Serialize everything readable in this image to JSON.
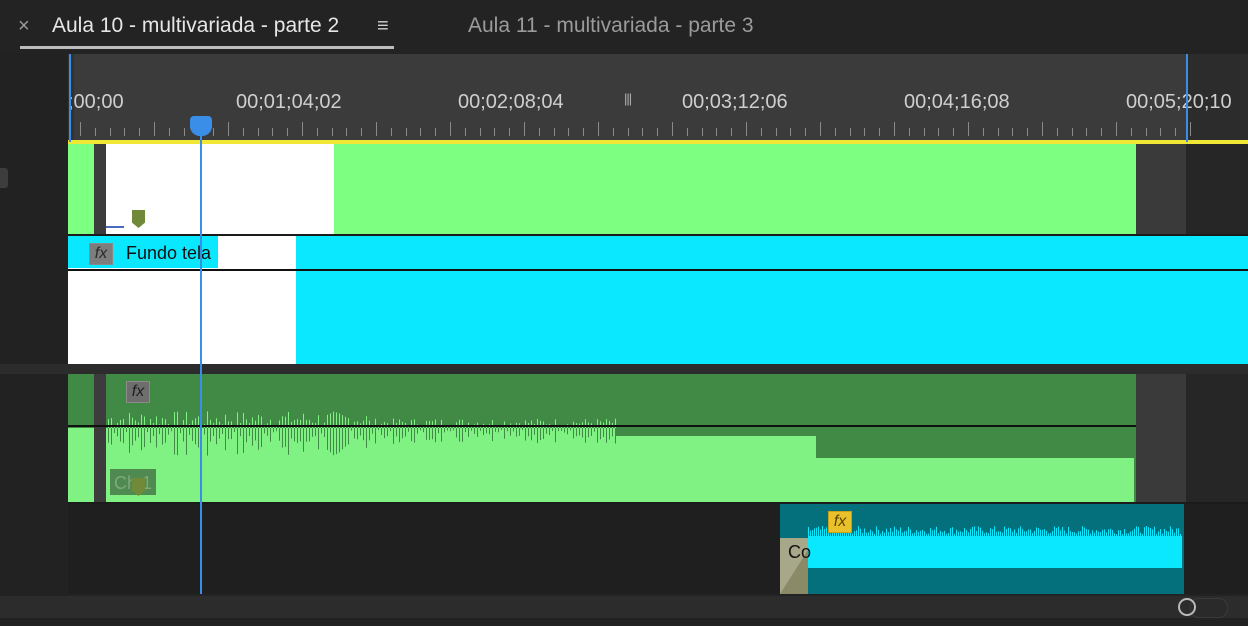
{
  "tabs": {
    "close_symbol": "×",
    "active": "Aula 10 - multivariada - parte 2",
    "menu_symbol": "≡",
    "inactive": "Aula 11 - multivariada - parte 3"
  },
  "ruler": {
    "labels": [
      ";00;00",
      "00;01;04;02",
      "00;02;08;04",
      "00;03;12;06",
      "00;04;16;08",
      "00;05;20;10"
    ],
    "grip": "|||"
  },
  "clips": {
    "video2_label": "Fundo tela",
    "audio1_label": "Ch 1",
    "audio2_label": "Co",
    "fx": "fx"
  },
  "colors": {
    "video1": "#7dff82",
    "video2": "#0ae8ff",
    "audio1_dark": "#418a45",
    "audio1_light": "#7ff283",
    "audio2_dark": "#03707c",
    "playhead": "#3a8ee8",
    "work_area": "#f0e634"
  }
}
